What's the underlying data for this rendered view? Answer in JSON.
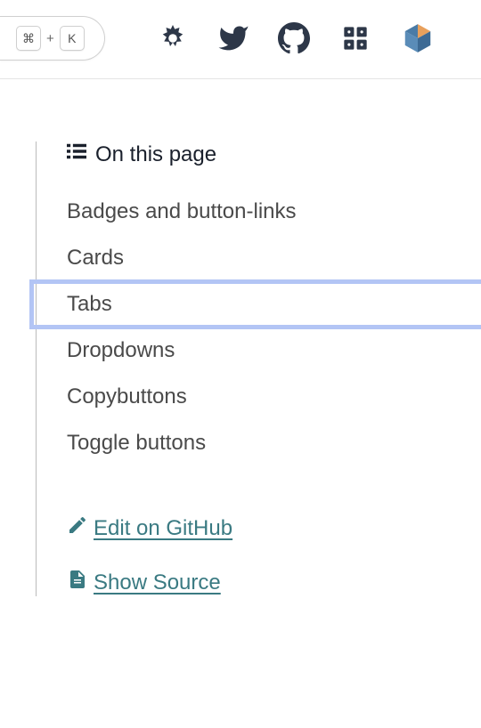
{
  "search": {
    "key1": "⌘",
    "plus": "+",
    "key2": "K"
  },
  "toc": {
    "header": "On this page",
    "items": [
      {
        "label": "Badges and button-links",
        "active": false
      },
      {
        "label": "Cards",
        "active": false
      },
      {
        "label": "Tabs",
        "active": true
      },
      {
        "label": "Dropdowns",
        "active": false
      },
      {
        "label": "Copybuttons",
        "active": false
      },
      {
        "label": "Toggle buttons",
        "active": false
      }
    ]
  },
  "actions": {
    "edit": "Edit on GitHub",
    "source": "Show Source"
  }
}
